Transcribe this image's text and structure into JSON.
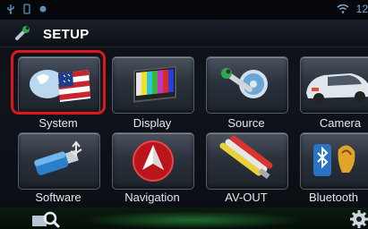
{
  "status": {
    "time": "12"
  },
  "header": {
    "title": "SETUP"
  },
  "tiles": [
    {
      "label": "System"
    },
    {
      "label": "Display"
    },
    {
      "label": "Source"
    },
    {
      "label": "Camera"
    },
    {
      "label": "Software"
    },
    {
      "label": "Navigation"
    },
    {
      "label": "AV-OUT"
    },
    {
      "label": "Bluetooth"
    }
  ],
  "selected_tile": "System",
  "colors": {
    "highlight": "#e0171a",
    "title_text": "#ffffff",
    "label_text": "#e6e6e6"
  }
}
